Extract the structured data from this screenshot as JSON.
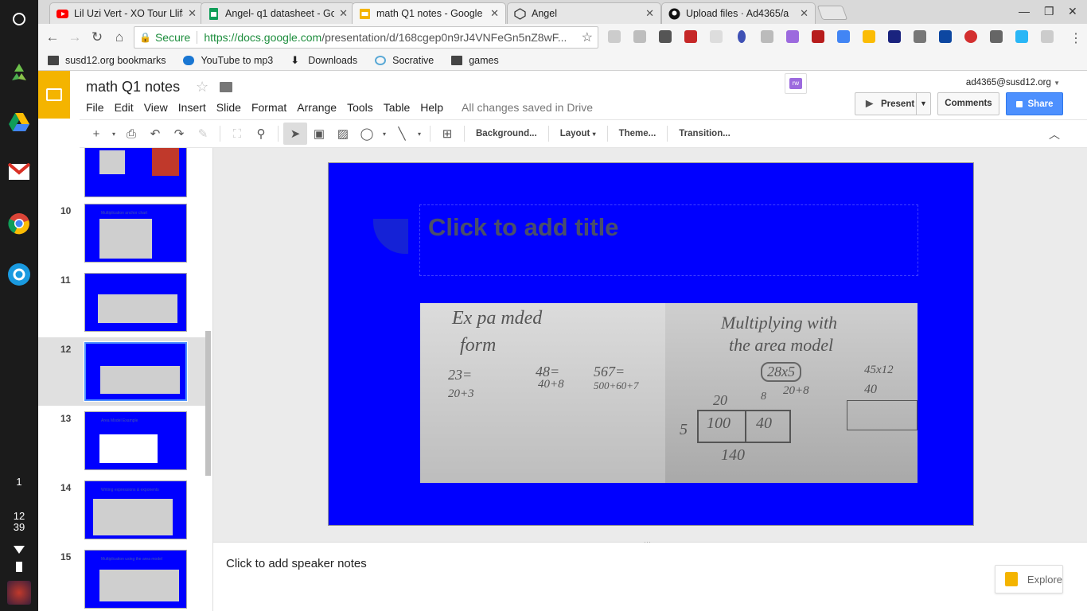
{
  "shelf": {
    "badge_count": "1",
    "time_hour": "12",
    "time_min": "39"
  },
  "tabs": [
    {
      "label": "Lil Uzi Vert - XO Tour Llif3",
      "icon": "youtube-icon",
      "color": "#ff0000"
    },
    {
      "label": "Angel- q1 datasheet - Go",
      "icon": "sheets-icon",
      "color": "#0f9d58"
    },
    {
      "label": "math Q1 notes - Google",
      "icon": "slides-icon",
      "color": "#f4b400",
      "active": true
    },
    {
      "label": "Angel",
      "icon": "codepen-icon",
      "color": "#333333"
    },
    {
      "label": "Upload files · Ad4365/a",
      "icon": "github-icon",
      "color": "#111111"
    }
  ],
  "omnibox": {
    "secure_label": "Secure",
    "url_host": "https://docs.google.com",
    "url_path": "/presentation/d/168cgep0n9rJ4VNFeGn5nZ8wF..."
  },
  "bookmarks": [
    {
      "label": "susd12.org bookmarks",
      "icon": "folder-icon"
    },
    {
      "label": "YouTube to mp3",
      "icon": "cloud-download-icon"
    },
    {
      "label": "Downloads",
      "icon": "download-icon"
    },
    {
      "label": "Socrative",
      "icon": "socrative-icon"
    },
    {
      "label": "games",
      "icon": "folder-icon"
    }
  ],
  "docs": {
    "title": "math Q1 notes",
    "user_email": "ad4365@susd12.org",
    "menu": [
      "File",
      "Edit",
      "View",
      "Insert",
      "Slide",
      "Format",
      "Arrange",
      "Tools",
      "Table",
      "Help"
    ],
    "save_status": "All changes saved in Drive",
    "present_label": "Present",
    "comments_label": "Comments",
    "share_label": "Share",
    "addon_label": "rw"
  },
  "edit_toolbar": {
    "background_label": "Background...",
    "layout_label": "Layout",
    "theme_label": "Theme...",
    "transition_label": "Transition..."
  },
  "filmstrip": [
    {
      "num": "",
      "caption": ""
    },
    {
      "num": "10",
      "caption": "Multiplication anchor chart"
    },
    {
      "num": "11",
      "caption": ""
    },
    {
      "num": "12",
      "caption": "",
      "selected": true
    },
    {
      "num": "13",
      "caption": "Area Model Example"
    },
    {
      "num": "14",
      "caption": "Writing expressions & exponents"
    },
    {
      "num": "15",
      "caption": "Multiplication using the area model"
    }
  ],
  "slide": {
    "title_placeholder": "Click to add title",
    "photo1_lines": [
      "Ex pa mded",
      "form",
      "23=",
      "48=",
      "567=",
      "20+3",
      "40+8",
      "500+60+7"
    ],
    "photo2_lines": [
      "Multiplying with",
      "the area model",
      "28x5",
      "45x12",
      "20+8",
      "20",
      "8",
      "40",
      "5",
      "100",
      "40",
      "140"
    ]
  },
  "notes": {
    "placeholder": "Click to add speaker notes",
    "explore_label": "Explore"
  },
  "colors": {
    "slide_bg": "#0000ff",
    "accent": "#4d90fe",
    "slides_yellow": "#f4b400"
  }
}
